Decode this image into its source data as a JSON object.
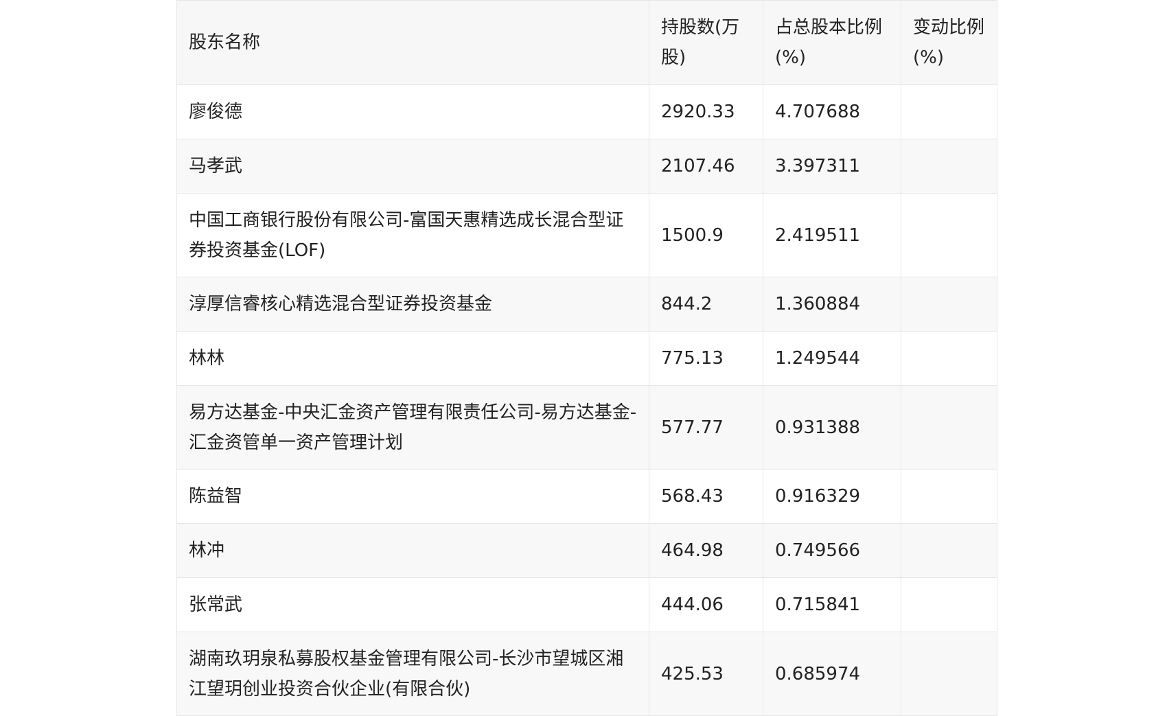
{
  "table": {
    "headers": [
      "股东名称",
      "持股数(万股)",
      "占总股本比例(%)",
      "变动比例(%)"
    ],
    "rows": [
      {
        "name": "廖俊德",
        "shares": "2920.33",
        "ratio": "4.707688",
        "change": ""
      },
      {
        "name": "马孝武",
        "shares": "2107.46",
        "ratio": "3.397311",
        "change": ""
      },
      {
        "name": "中国工商银行股份有限公司-富国天惠精选成长混合型证券投资基金(LOF)",
        "shares": "1500.9",
        "ratio": "2.419511",
        "change": ""
      },
      {
        "name": "淳厚信睿核心精选混合型证券投资基金",
        "shares": "844.2",
        "ratio": "1.360884",
        "change": ""
      },
      {
        "name": "林林",
        "shares": "775.13",
        "ratio": "1.249544",
        "change": ""
      },
      {
        "name": "易方达基金-中央汇金资产管理有限责任公司-易方达基金-汇金资管单一资产管理计划",
        "shares": "577.77",
        "ratio": "0.931388",
        "change": ""
      },
      {
        "name": "陈益智",
        "shares": "568.43",
        "ratio": "0.916329",
        "change": ""
      },
      {
        "name": "林冲",
        "shares": "464.98",
        "ratio": "0.749566",
        "change": ""
      },
      {
        "name": "张常武",
        "shares": "444.06",
        "ratio": "0.715841",
        "change": ""
      },
      {
        "name": "湖南玖玥泉私募股权基金管理有限公司-长沙市望城区湘江望玥创业投资合伙企业(有限合伙)",
        "shares": "425.53",
        "ratio": "0.685974",
        "change": ""
      }
    ]
  }
}
